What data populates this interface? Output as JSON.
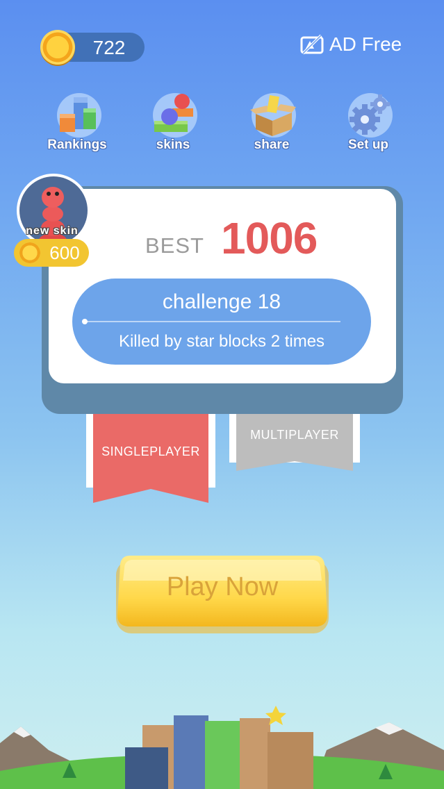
{
  "header": {
    "coins": "722",
    "ad_free_label": "AD Free"
  },
  "menu": [
    {
      "label": "Rankings",
      "icon": "rankings-icon"
    },
    {
      "label": "skins",
      "icon": "skins-icon"
    },
    {
      "label": "share",
      "icon": "share-icon"
    },
    {
      "label": "Set up",
      "icon": "settings-icon"
    }
  ],
  "new_skin": {
    "label": "new skin",
    "price": "600"
  },
  "best": {
    "label": "BEST",
    "value": "1006"
  },
  "challenge": {
    "title": "challenge 18",
    "subtitle": "Killed by star blocks 2 times"
  },
  "modes": {
    "single": "SINGLEPLAYER",
    "multi": "MULTIPLAYER"
  },
  "play_label": "Play Now",
  "colors": {
    "accent_red": "#e35a5a",
    "challenge_blue": "#6da4ea",
    "play_yellow": "#ffd94a",
    "card_border": "#5f88a8"
  }
}
